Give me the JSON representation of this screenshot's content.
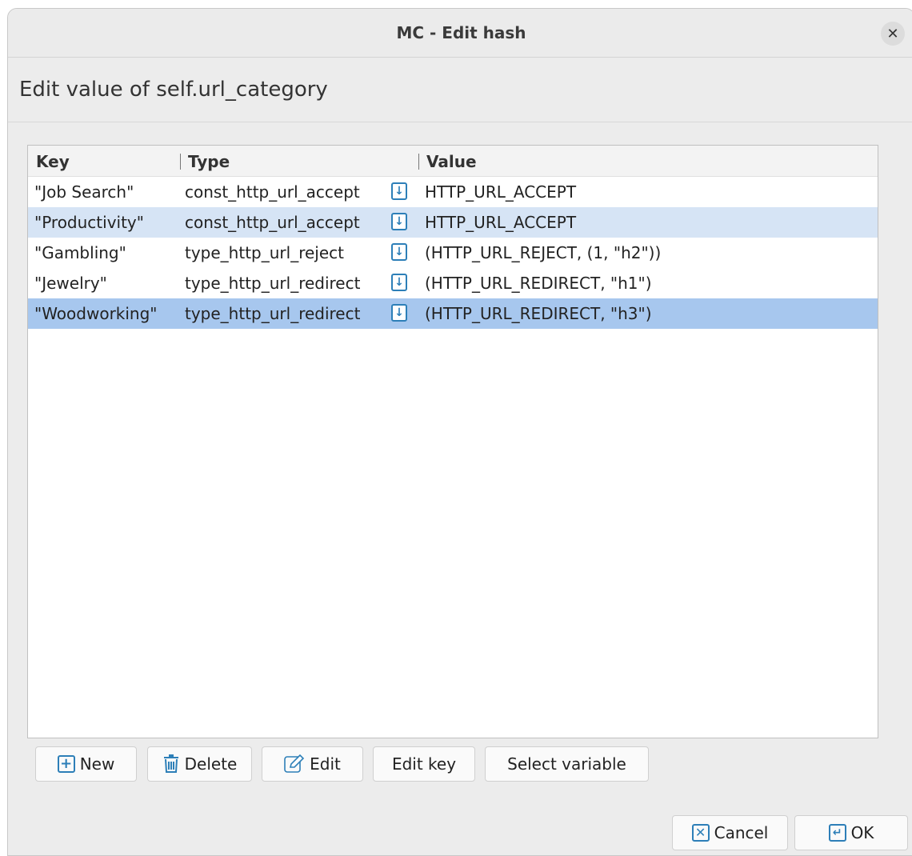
{
  "window": {
    "title": "MC - Edit hash"
  },
  "dialog": {
    "subtitle": "Edit value of self.url_category"
  },
  "table": {
    "headers": {
      "key": "Key",
      "type": "Type",
      "value": "Value"
    },
    "rows": [
      {
        "key": "\"Job Search\"",
        "type": "const_http_url_accept",
        "value": "HTTP_URL_ACCEPT",
        "state": "none"
      },
      {
        "key": "\"Productivity\"",
        "type": "const_http_url_accept",
        "value": "HTTP_URL_ACCEPT",
        "state": "hover"
      },
      {
        "key": "\"Gambling\"",
        "type": "type_http_url_reject",
        "value": "(HTTP_URL_REJECT, (1, \"h2\"))",
        "state": "none"
      },
      {
        "key": "\"Jewelry\"",
        "type": "type_http_url_redirect",
        "value": "(HTTP_URL_REDIRECT, \"h1\")",
        "state": "none"
      },
      {
        "key": "\"Woodworking\"",
        "type": "type_http_url_redirect",
        "value": "(HTTP_URL_REDIRECT, \"h3\")",
        "state": "selected"
      }
    ]
  },
  "actions": {
    "new_label": "New",
    "delete_label": "Delete",
    "edit_label": "Edit",
    "edit_key_label": "Edit key",
    "select_variable_label": "Select variable"
  },
  "footer": {
    "cancel_label": "Cancel",
    "ok_label": "OK"
  },
  "colors": {
    "accent": "#2d7fb8",
    "hover_row": "#d6e4f5",
    "selected_row": "#a7c7ee"
  }
}
